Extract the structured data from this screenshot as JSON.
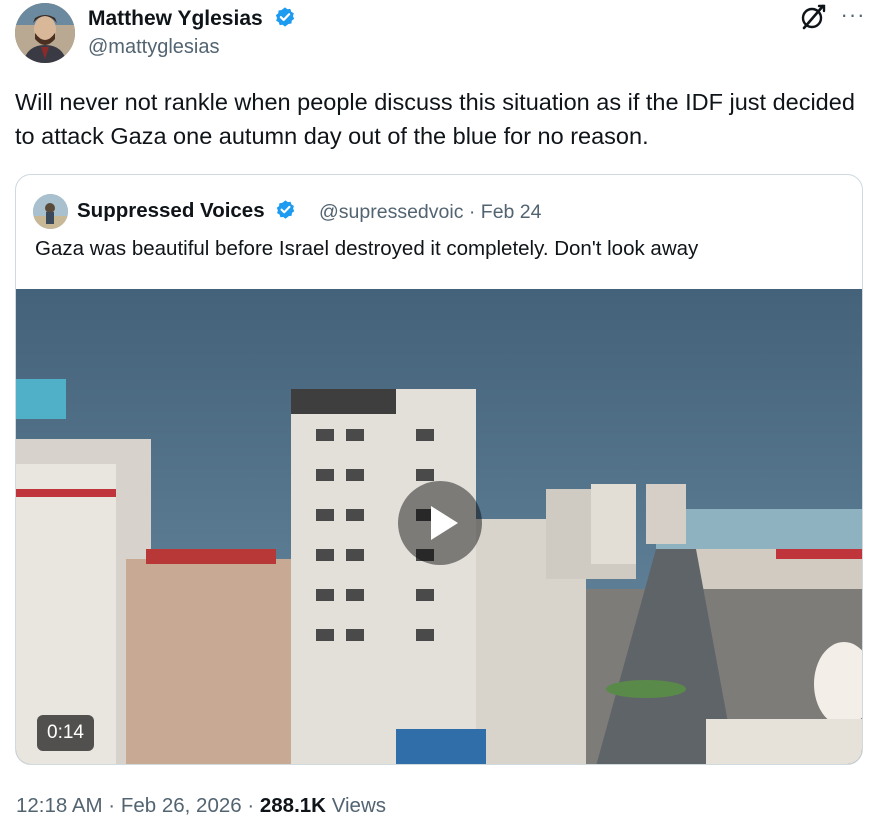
{
  "tweet": {
    "author_name": "Matthew Yglesias",
    "author_handle": "@mattyglesias",
    "text": "Will never not rankle when people discuss this situation as if the IDF just decided to attack Gaza one autumn day out of the blue for no reason.",
    "more_label": "···",
    "timestamp": "12:18 AM · Feb 26, 2026",
    "separator": " · ",
    "views_count": "288.1K",
    "views_label": "Views"
  },
  "quoted_tweet": {
    "author_name": "Suppressed Voices",
    "author_handle": "@supressedvoic",
    "date_meta": "· Feb 24",
    "text": "Gaza was beautiful before Israel destroyed it completely. Don't look away",
    "video_duration": "0:14"
  },
  "colors": {
    "verified_blue": "#1d9bf0",
    "text_primary": "#0f1419",
    "text_secondary": "#536471",
    "border": "#cfd9de"
  },
  "icons": [
    "verified-badge-icon",
    "grok-icon",
    "more-icon",
    "play-icon"
  ]
}
